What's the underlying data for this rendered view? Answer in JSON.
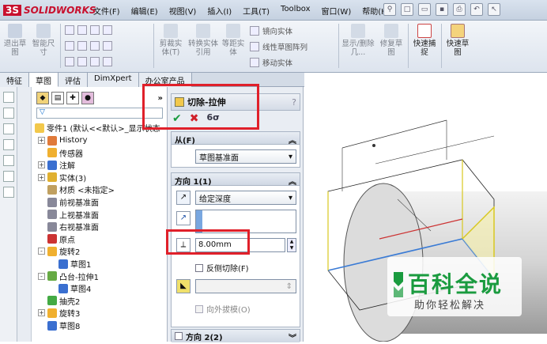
{
  "app": {
    "logo": "SOLIDWORKS"
  },
  "menu": [
    "文件(F)",
    "编辑(E)",
    "视图(V)",
    "插入(I)",
    "工具(T)",
    "Toolbox",
    "窗口(W)",
    "帮助(H)"
  ],
  "toolbar": {
    "exit_sketch": "退出草图",
    "smart_dim": "智能尺寸",
    "trim": "剪裁实体(T)",
    "convert": "转换实体引用",
    "offset": "等距实体",
    "mirror": "镜向实体",
    "linear_pattern": "线性草图阵列",
    "move": "移动实体",
    "show_delete": "显示/删除几...",
    "repair": "修复草图",
    "quick_snap": "快速捕捉",
    "rapid_sketch": "快速草图"
  },
  "tabs": [
    "特征",
    "草图",
    "评估",
    "DimXpert",
    "办公室产品"
  ],
  "tree": {
    "filter": "▽",
    "root": "零件1 (默认<<默认>_显示状态",
    "items": [
      {
        "label": "History",
        "indent": 1,
        "expand": "+"
      },
      {
        "label": "传感器",
        "indent": 1,
        "expand": ""
      },
      {
        "label": "注解",
        "indent": 1,
        "expand": "+"
      },
      {
        "label": "实体(3)",
        "indent": 1,
        "expand": "+"
      },
      {
        "label": "材质 <未指定>",
        "indent": 1,
        "expand": ""
      },
      {
        "label": "前视基准面",
        "indent": 1,
        "expand": ""
      },
      {
        "label": "上视基准面",
        "indent": 1,
        "expand": ""
      },
      {
        "label": "右视基准面",
        "indent": 1,
        "expand": ""
      },
      {
        "label": "原点",
        "indent": 1,
        "expand": ""
      },
      {
        "label": "旋转2",
        "indent": 1,
        "expand": "-"
      },
      {
        "label": "草图1",
        "indent": 2,
        "expand": ""
      },
      {
        "label": "凸台-拉伸1",
        "indent": 1,
        "expand": "-"
      },
      {
        "label": "草图4",
        "indent": 2,
        "expand": ""
      },
      {
        "label": "抽壳2",
        "indent": 1,
        "expand": ""
      },
      {
        "label": "旋转3",
        "indent": 1,
        "expand": "+"
      },
      {
        "label": "草图8",
        "indent": 1,
        "expand": ""
      }
    ]
  },
  "property_manager": {
    "title": "切除-拉伸",
    "help": "?",
    "ok": "✔",
    "cancel": "✖",
    "preview": "6σ",
    "from": {
      "header": "从(F)",
      "value": "草图基准面"
    },
    "dir1": {
      "header": "方向 1(1)",
      "end_condition": "给定深度",
      "depth": "8.00mm",
      "flip_side": "反侧切除(F)",
      "draft_outward": "向外拔模(O)"
    },
    "dir2": {
      "header": "方向 2(2)"
    }
  },
  "watermark": {
    "title": "百科全说",
    "subtitle": "助你轻松解决"
  }
}
